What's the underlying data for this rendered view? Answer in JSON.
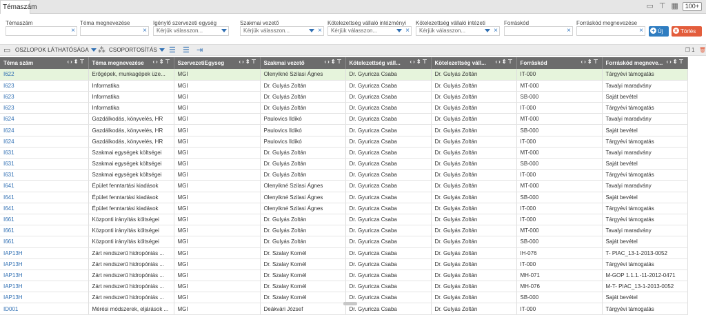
{
  "tab": {
    "label": "Témaszám"
  },
  "top_right": {
    "badge": "100+"
  },
  "filters": [
    {
      "label": "Témaszám",
      "value": "",
      "placeholder": "",
      "dropdown": false
    },
    {
      "label": "Téma megnevezése",
      "value": "",
      "placeholder": "",
      "dropdown": false
    },
    {
      "label": "Igénylő szervezeti egység",
      "value": "",
      "placeholder": "Kérjük válasszon...",
      "dropdown": true,
      "clear": false
    },
    {
      "label": "Szakmai vezető",
      "value": "",
      "placeholder": "Kérjük válasszon...",
      "dropdown": true,
      "clear": true
    },
    {
      "label": "Kötelezettség vállaló intézményi",
      "value": "",
      "placeholder": "Kérjük válasszon...",
      "dropdown": true,
      "clear": true
    },
    {
      "label": "Kötelezettség vállaló intézeti",
      "value": "",
      "placeholder": "Kérjük válasszon...",
      "dropdown": true,
      "clear": true
    },
    {
      "label": "Forráskód",
      "value": "",
      "placeholder": "",
      "dropdown": false
    },
    {
      "label": "Forráskód megnevezése",
      "value": "",
      "placeholder": "",
      "dropdown": false
    }
  ],
  "buttons": {
    "new": "Új",
    "delete": "Törlés"
  },
  "toolbar": {
    "columns": "OSZLOPOK LÁTHATÓSÁGA",
    "grouping": "CSOPORTOSÍTÁS",
    "count": "1"
  },
  "table": {
    "headers": [
      "Téma szám",
      "Téma megnevezése",
      "SzervezetiEgyseg",
      "Szakmai vezető",
      "Kötelezettség váll...",
      "Kötelezettség váll...",
      "Forráskód",
      "Forráskód megneve..."
    ],
    "rows": [
      [
        "I622",
        "Erőgépek, munkagépek üze...",
        "MGI",
        "Olenyikné Szilasi Ágnes",
        "Dr. Gyuricza Csaba",
        "Dr. Gulyás Zoltán",
        "IT-000",
        "Tárgyévi támogatás"
      ],
      [
        "I623",
        "Informatika",
        "MGI",
        "Dr. Gulyás Zoltán",
        "Dr. Gyuricza Csaba",
        "Dr. Gulyás Zoltán",
        "MT-000",
        "Tavalyi maradvány"
      ],
      [
        "I623",
        "Informatika",
        "MGI",
        "Dr. Gulyás Zoltán",
        "Dr. Gyuricza Csaba",
        "Dr. Gulyás Zoltán",
        "SB-000",
        "Saját bevétel"
      ],
      [
        "I623",
        "Informatika",
        "MGI",
        "Dr. Gulyás Zoltán",
        "Dr. Gyuricza Csaba",
        "Dr. Gulyás Zoltán",
        "IT-000",
        "Tárgyévi támogatás"
      ],
      [
        "I624",
        "Gazdálkodás, könyvelés, HR",
        "MGI",
        "Paulovics Ildikó",
        "Dr. Gyuricza Csaba",
        "Dr. Gulyás Zoltán",
        "MT-000",
        "Tavalyi maradvány"
      ],
      [
        "I624",
        "Gazdálkodás, könyvelés, HR",
        "MGI",
        "Paulovics Ildikó",
        "Dr. Gyuricza Csaba",
        "Dr. Gulyás Zoltán",
        "SB-000",
        "Saját bevétel"
      ],
      [
        "I624",
        "Gazdálkodás, könyvelés, HR",
        "MGI",
        "Paulovics Ildikó",
        "Dr. Gyuricza Csaba",
        "Dr. Gulyás Zoltán",
        "IT-000",
        "Tárgyévi támogatás"
      ],
      [
        "I631",
        "Szakmai egységek költségei",
        "MGI",
        "Dr. Gulyás Zoltán",
        "Dr. Gyuricza Csaba",
        "Dr. Gulyás Zoltán",
        "MT-000",
        "Tavalyi maradvány"
      ],
      [
        "I631",
        "Szakmai egységek költségei",
        "MGI",
        "Dr. Gulyás Zoltán",
        "Dr. Gyuricza Csaba",
        "Dr. Gulyás Zoltán",
        "SB-000",
        "Saját bevétel"
      ],
      [
        "I631",
        "Szakmai egységek költségei",
        "MGI",
        "Dr. Gulyás Zoltán",
        "Dr. Gyuricza Csaba",
        "Dr. Gulyás Zoltán",
        "IT-000",
        "Tárgyévi támogatás"
      ],
      [
        "I641",
        "Épület fenntartási kiadások",
        "MGI",
        "Olenyikné Szilasi Ágnes",
        "Dr. Gyuricza Csaba",
        "Dr. Gulyás Zoltán",
        "MT-000",
        "Tavalyi maradvány"
      ],
      [
        "I641",
        "Épület fenntartási kiadások",
        "MGI",
        "Olenyikné Szilasi Ágnes",
        "Dr. Gyuricza Csaba",
        "Dr. Gulyás Zoltán",
        "SB-000",
        "Saját bevétel"
      ],
      [
        "I641",
        "Épület fenntartási kiadások",
        "MGI",
        "Olenyikné Szilasi Ágnes",
        "Dr. Gyuricza Csaba",
        "Dr. Gulyás Zoltán",
        "IT-000",
        "Tárgyévi támogatás"
      ],
      [
        "I661",
        "Központi irányítás költségei",
        "MGI",
        "Dr. Gulyás Zoltán",
        "Dr. Gyuricza Csaba",
        "Dr. Gulyás Zoltán",
        "IT-000",
        "Tárgyévi támogatás"
      ],
      [
        "I661",
        "Központi irányítás költségei",
        "MGI",
        "Dr. Gulyás Zoltán",
        "Dr. Gyuricza Csaba",
        "Dr. Gulyás Zoltán",
        "MT-000",
        "Tavalyi maradvány"
      ],
      [
        "I661",
        "Központi irányítás költségei",
        "MGI",
        "Dr. Gulyás Zoltán",
        "Dr. Gyuricza Csaba",
        "Dr. Gulyás Zoltán",
        "SB-000",
        "Saját bevétel"
      ],
      [
        "IAP13H",
        "Zárt rendszerű hidropóniás ...",
        "MGI",
        "Dr. Szalay Kornél",
        "Dr. Gyuricza Csaba",
        "Dr. Gulyás Zoltán",
        "IH-076",
        "T- PIAC_13-1-2013-0052"
      ],
      [
        "IAP13H",
        "Zárt rendszerű hidropóniás ...",
        "MGI",
        "Dr. Szalay Kornél",
        "Dr. Gyuricza Csaba",
        "Dr. Gulyás Zoltán",
        "IT-000",
        "Tárgyévi támogatás"
      ],
      [
        "IAP13H",
        "Zárt rendszerű hidropóniás ...",
        "MGI",
        "Dr. Szalay Kornél",
        "Dr. Gyuricza Csaba",
        "Dr. Gulyás Zoltán",
        "MH-071",
        "M-GOP 1.1.1.-11-2012-0471"
      ],
      [
        "IAP13H",
        "Zárt rendszerű hidropóniás ...",
        "MGI",
        "Dr. Szalay Kornél",
        "Dr. Gyuricza Csaba",
        "Dr. Gulyás Zoltán",
        "MH-076",
        "M-T- PIAC_13-1-2013-0052"
      ],
      [
        "IAP13H",
        "Zárt rendszerű hidropóniás ...",
        "MGI",
        "Dr. Szalay Kornél",
        "Dr. Gyuricza Csaba",
        "Dr. Gulyás Zoltán",
        "SB-000",
        "Saját bevétel"
      ],
      [
        "ID001",
        "Mérési módszerek, eljárások ...",
        "MGI",
        "Deákvári József",
        "Dr. Gyuricza Csaba",
        "Dr. Gulyás Zoltán",
        "IT-000",
        "Tárgyévi támogatás"
      ]
    ]
  }
}
